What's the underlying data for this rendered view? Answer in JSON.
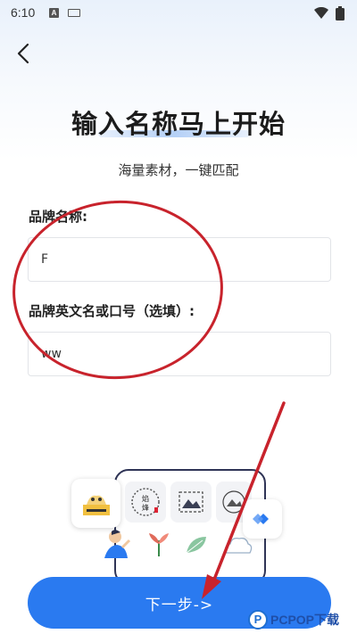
{
  "status": {
    "time": "6:10",
    "left_icons": [
      "a-letter-icon",
      "keyboard-icon"
    ],
    "right_icons": [
      "wifi-icon",
      "battery-icon"
    ]
  },
  "nav": {
    "back_icon": "chevron-left-icon"
  },
  "page": {
    "title": "输入名称马上开始",
    "subtitle": "海量素材，一键匹配"
  },
  "form": {
    "brand_name_label": "品牌名称:",
    "brand_name_value": "F",
    "brand_en_label": "品牌英文名或口号（选填）:",
    "brand_en_value": "ww"
  },
  "preview": {
    "tile_icons": [
      "shop-sign-icon",
      "seal-icon",
      "landscape-icon",
      "photo-icon",
      "person-icon",
      "plant-icon",
      "leaf-icon",
      "cloud-icon"
    ],
    "stamp_text": "焰烽"
  },
  "actions": {
    "next_label": "下一步->"
  },
  "watermark": {
    "logo_letter": "P",
    "text": "PCPOP下载"
  },
  "colors": {
    "primary": "#2a7af0",
    "annotation": "#c8232c",
    "title_highlight": "#78aaf0"
  }
}
